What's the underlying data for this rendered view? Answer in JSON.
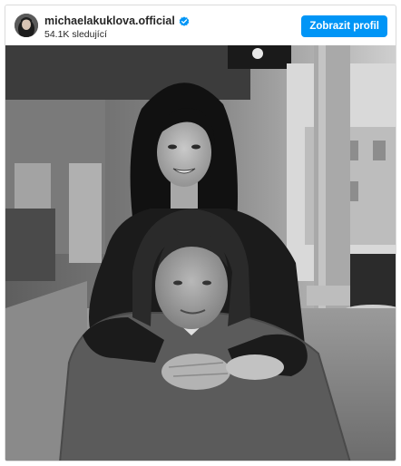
{
  "post": {
    "username": "michaelakuklova.official",
    "verified": true,
    "followers_text": "54.1K sledující",
    "follow_button_label": "Zobrazit profil"
  },
  "photo": {
    "style": "black-and-white",
    "subjects": [
      "woman-with-long-dark-hair",
      "man-with-long-hair-in-knit-sweater"
    ]
  },
  "icons": {
    "verified": "verified-badge-icon"
  },
  "colors": {
    "accent": "#0095f6",
    "verified": "#0095f6",
    "text": "#262626",
    "border": "#dbdbdb"
  }
}
